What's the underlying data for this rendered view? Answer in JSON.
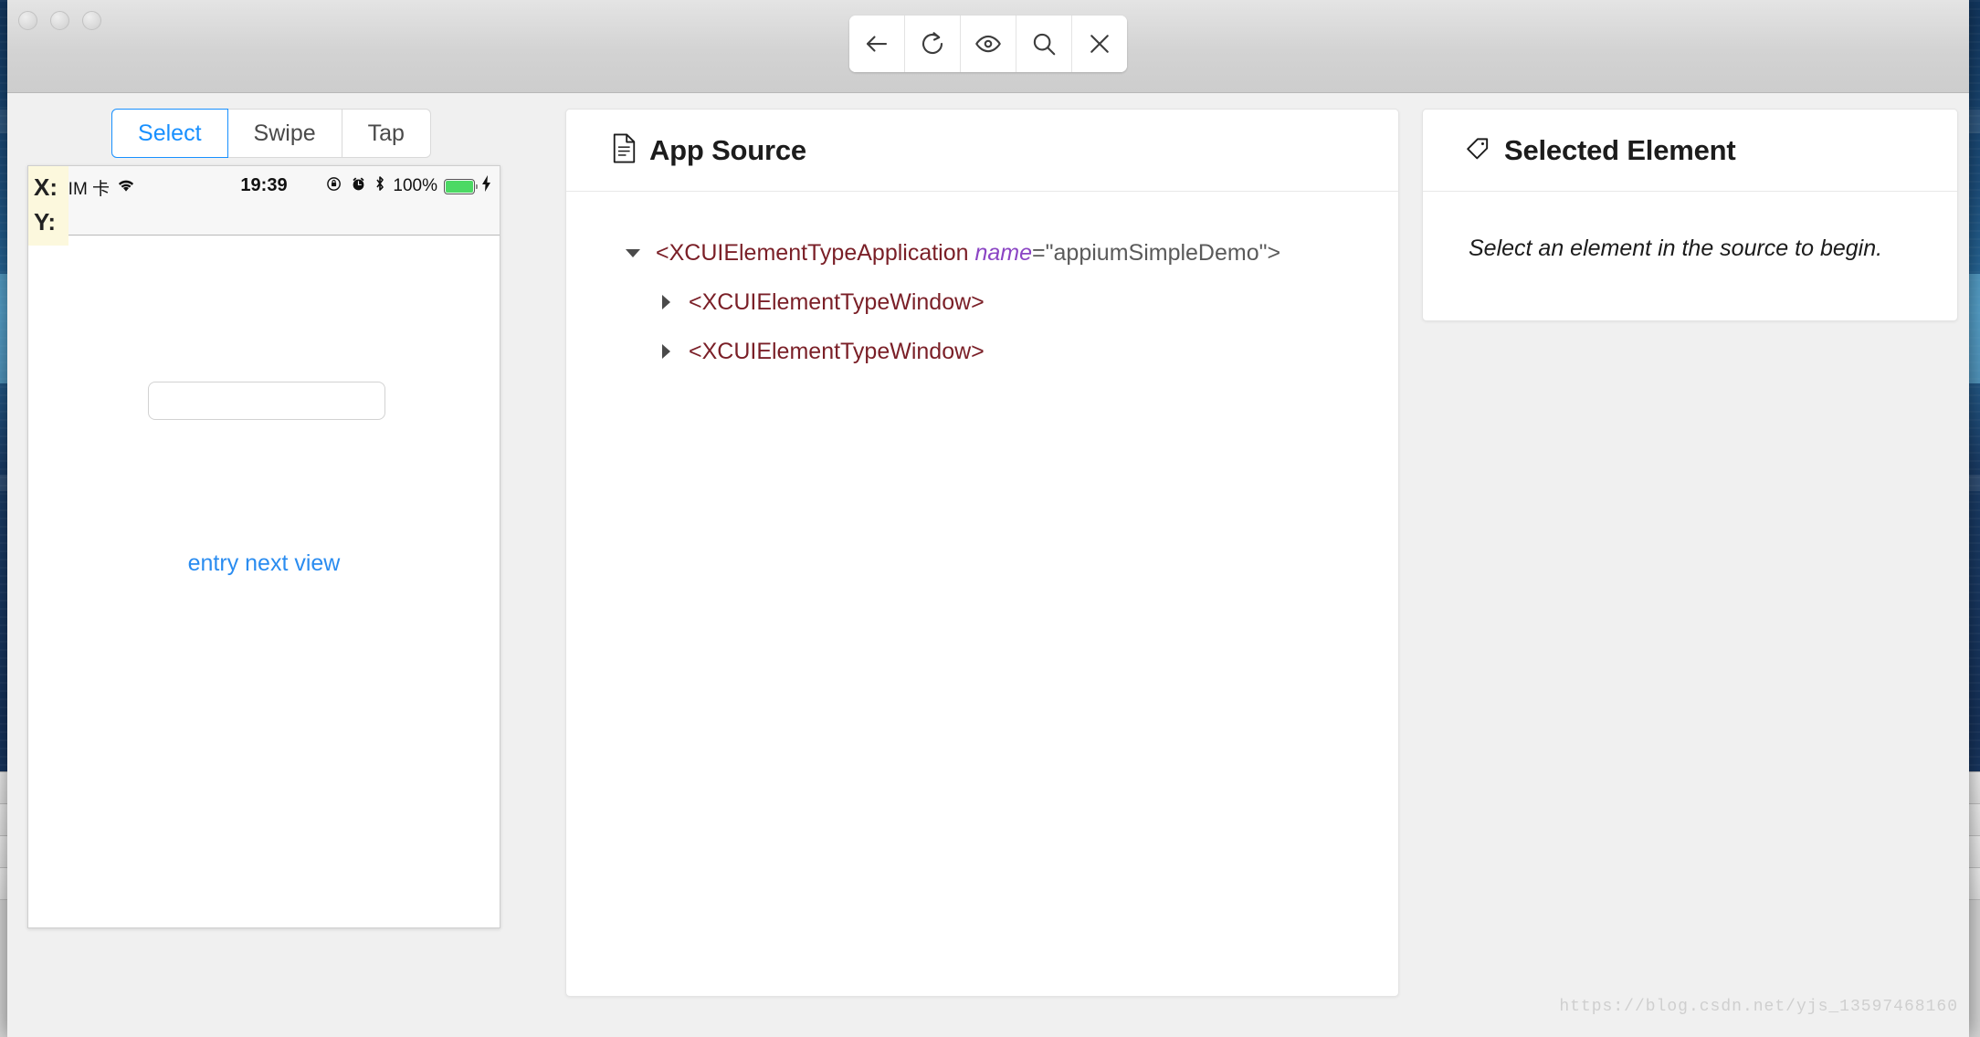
{
  "window": {
    "traffic_lights": [
      "close",
      "minimize",
      "zoom"
    ]
  },
  "toolbar": {
    "buttons": [
      {
        "name": "back-button",
        "icon": "arrow-left-icon"
      },
      {
        "name": "refresh-button",
        "icon": "refresh-icon"
      },
      {
        "name": "eye-button",
        "icon": "eye-icon"
      },
      {
        "name": "search-button",
        "icon": "search-icon"
      },
      {
        "name": "close-button",
        "icon": "close-icon"
      }
    ]
  },
  "device_panel": {
    "mode_tabs": [
      {
        "label": "Select",
        "active": true
      },
      {
        "label": "Swipe",
        "active": false
      },
      {
        "label": "Tap",
        "active": false
      }
    ],
    "coordinates": {
      "x_label": "X:",
      "y_label": "Y:",
      "x_value": "",
      "y_value": "",
      "highlight_color": "#fcf8dd"
    },
    "status_bar": {
      "carrier": "SIM 卡",
      "wifi_icon": "wifi-icon",
      "time": "19:39",
      "rotation_lock_icon": "rotation-lock-icon",
      "alarm_icon": "alarm-clock-icon",
      "bluetooth_icon": "bluetooth-icon",
      "battery_percent": "100%",
      "battery_color": "#4cd964",
      "charging_icon": "lightning-bolt-icon"
    },
    "screen": {
      "text_field_value": "",
      "text_field_placeholder": "",
      "link_label": "entry next view",
      "link_color": "#2a8cf0"
    }
  },
  "app_source": {
    "title": "App Source",
    "icon": "document-icon",
    "tree": [
      {
        "indent": 1,
        "caret": "down",
        "expanded": true,
        "prefix": "<XCUIElementTypeApplication",
        "attr_name": "name",
        "attr_eq": "=\"appiumSimpleDemo\">",
        "has_attr": true
      },
      {
        "indent": 2,
        "caret": "right",
        "expanded": false,
        "prefix": "<XCUIElementTypeWindow>",
        "has_attr": false
      },
      {
        "indent": 2,
        "caret": "right",
        "expanded": false,
        "prefix": "<XCUIElementTypeWindow>",
        "has_attr": false
      }
    ]
  },
  "selected_element": {
    "title": "Selected Element",
    "icon": "tag-icon",
    "empty_message": "Select an element in the source to begin."
  },
  "watermark": {
    "text": "https://blog.csdn.net/yjs_13597468160"
  }
}
